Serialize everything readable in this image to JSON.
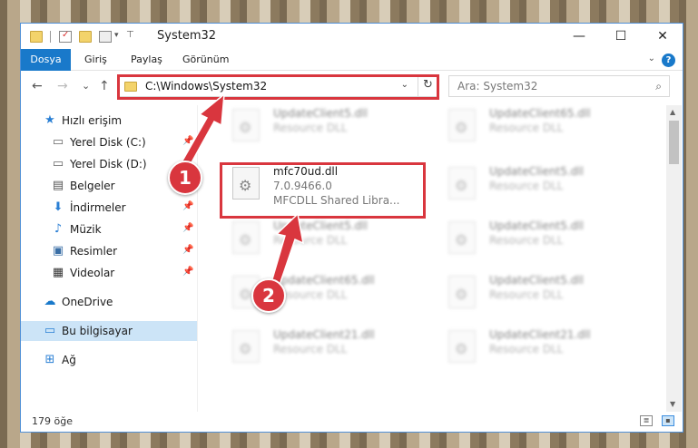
{
  "window": {
    "title": "System32",
    "controls": {
      "minimize": "—",
      "maximize": "☐",
      "close": "✕"
    }
  },
  "ribbon": {
    "file_tab": "Dosya",
    "tabs": [
      "Giriş",
      "Paylaş",
      "Görünüm"
    ],
    "help": "?"
  },
  "navbar": {
    "back": "←",
    "forward": "→",
    "recent": "⌄",
    "up": "↑",
    "address": "C:\\Windows\\System32",
    "search_placeholder": "Ara: System32"
  },
  "sidebar": {
    "quick_access": "Hızlı erişim",
    "items": [
      {
        "label": "Yerel Disk (C:)",
        "icon": "drive-icon"
      },
      {
        "label": "Yerel Disk (D:)",
        "icon": "drive-icon"
      },
      {
        "label": "Belgeler",
        "icon": "documents-icon"
      },
      {
        "label": "İndirmeler",
        "icon": "download-icon"
      },
      {
        "label": "Müzik",
        "icon": "music-icon"
      },
      {
        "label": "Resimler",
        "icon": "pictures-icon"
      },
      {
        "label": "Videolar",
        "icon": "videos-icon"
      }
    ],
    "onedrive": "OneDrive",
    "this_pc": "Bu bilgisayar",
    "network": "Ağ"
  },
  "files": {
    "focused": {
      "name": "mfc70ud.dll",
      "version": "7.0.9466.0",
      "description": "MFCDLL Shared Libra..."
    },
    "left_column": [
      {
        "name": "UpdateClient5.dll",
        "type": "Resource DLL"
      },
      {
        "name": "UpdateClient5.dll",
        "type": "Resource DLL"
      },
      {
        "name": "UpdateClient65.dll",
        "type": "Resource DLL"
      },
      {
        "name": "UpdateClient21.dll",
        "type": "Resource DLL"
      }
    ],
    "right_column": [
      {
        "name": "UpdateClient65.dll",
        "type": "Resource DLL"
      },
      {
        "name": "UpdateClient5.dll",
        "type": "Resource DLL"
      },
      {
        "name": "UpdateClient5.dll",
        "type": "Resource DLL"
      },
      {
        "name": "UpdateClient5.dll",
        "type": "Resource DLL"
      },
      {
        "name": "UpdateClient21.dll",
        "type": "Resource DLL"
      }
    ]
  },
  "status": {
    "item_count": "179 öğe"
  },
  "callouts": [
    "1",
    "2"
  ],
  "colors": {
    "accent": "#1979ca",
    "highlight": "#d9363e",
    "selected": "#cce4f7"
  }
}
